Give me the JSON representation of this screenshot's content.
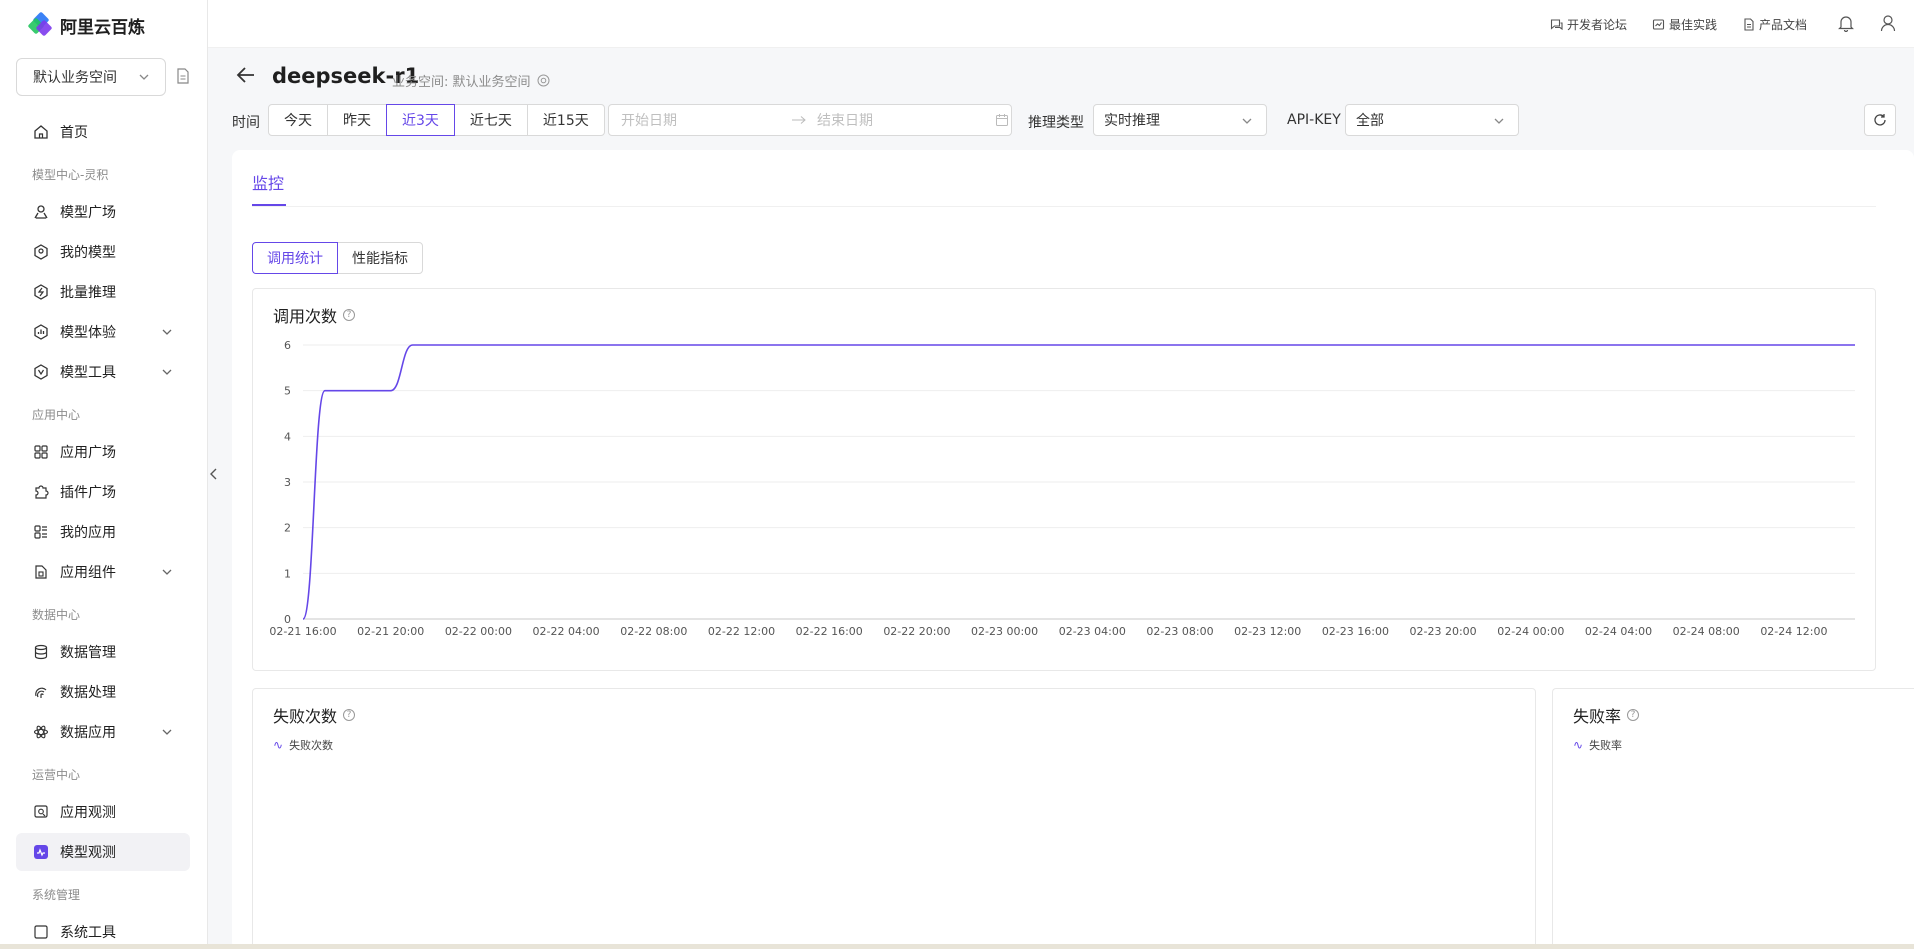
{
  "brand": {
    "name": "阿里云百炼"
  },
  "workspace": {
    "selected": "默认业务空间"
  },
  "nav": {
    "home": "首页",
    "group_model": "模型中心-灵积",
    "model_plaza": "模型广场",
    "my_models": "我的模型",
    "batch_infer": "批量推理",
    "model_exp": "模型体验",
    "model_tools": "模型工具",
    "group_app": "应用中心",
    "app_plaza": "应用广场",
    "plugin_plaza": "插件广场",
    "my_apps": "我的应用",
    "app_components": "应用组件",
    "group_data": "数据中心",
    "data_mgmt": "数据管理",
    "data_proc": "数据处理",
    "data_apps": "数据应用",
    "group_ops": "运营中心",
    "app_observe": "应用观测",
    "model_observe": "模型观测",
    "group_sys": "系统管理",
    "sys_tools": "系统工具"
  },
  "topbar": {
    "forum": "开发者论坛",
    "practice": "最佳实践",
    "docs": "产品文档"
  },
  "header": {
    "title": "deepseek-r1",
    "workspace_label": "业务空间: 默认业务空间"
  },
  "filters": {
    "time_label": "时间",
    "time_options": [
      "今天",
      "昨天",
      "近3天",
      "近七天",
      "近15天"
    ],
    "selected_time": "近3天",
    "start_placeholder": "开始日期",
    "end_placeholder": "结束日期",
    "infer_type_label": "推理类型",
    "infer_type_value": "实时推理",
    "apikey_label": "API-KEY",
    "apikey_value": "全部"
  },
  "tabs": {
    "monitor": "监控"
  },
  "subtabs": {
    "call_stats": "调用统计",
    "perf": "性能指标"
  },
  "cards": {
    "calls_title": "调用次数",
    "fail_title": "失败次数",
    "fail_legend": "失败次数",
    "failrate_title": "失败率",
    "failrate_legend": "失败率"
  },
  "colors": {
    "accent": "#6547e8"
  },
  "chart_data": {
    "type": "line",
    "title": "调用次数",
    "x": [
      "02-21 16:00",
      "02-21 17:00",
      "02-21 18:00",
      "02-21 20:00",
      "02-21 21:00",
      "02-24 17:00"
    ],
    "values": [
      0,
      5,
      5,
      5,
      6,
      6
    ],
    "xticks": [
      "02-21 16:00",
      "02-21 20:00",
      "02-22 00:00",
      "02-22 04:00",
      "02-22 08:00",
      "02-22 12:00",
      "02-22 16:00",
      "02-22 20:00",
      "02-23 00:00",
      "02-23 04:00",
      "02-23 08:00",
      "02-23 12:00",
      "02-23 16:00",
      "02-23 20:00",
      "02-24 00:00",
      "02-24 04:00",
      "02-24 08:00",
      "02-24 12:00"
    ],
    "yticks": [
      "0",
      "1",
      "2",
      "3",
      "4",
      "5",
      "6"
    ],
    "ylim": [
      0,
      6
    ],
    "grid": true
  }
}
